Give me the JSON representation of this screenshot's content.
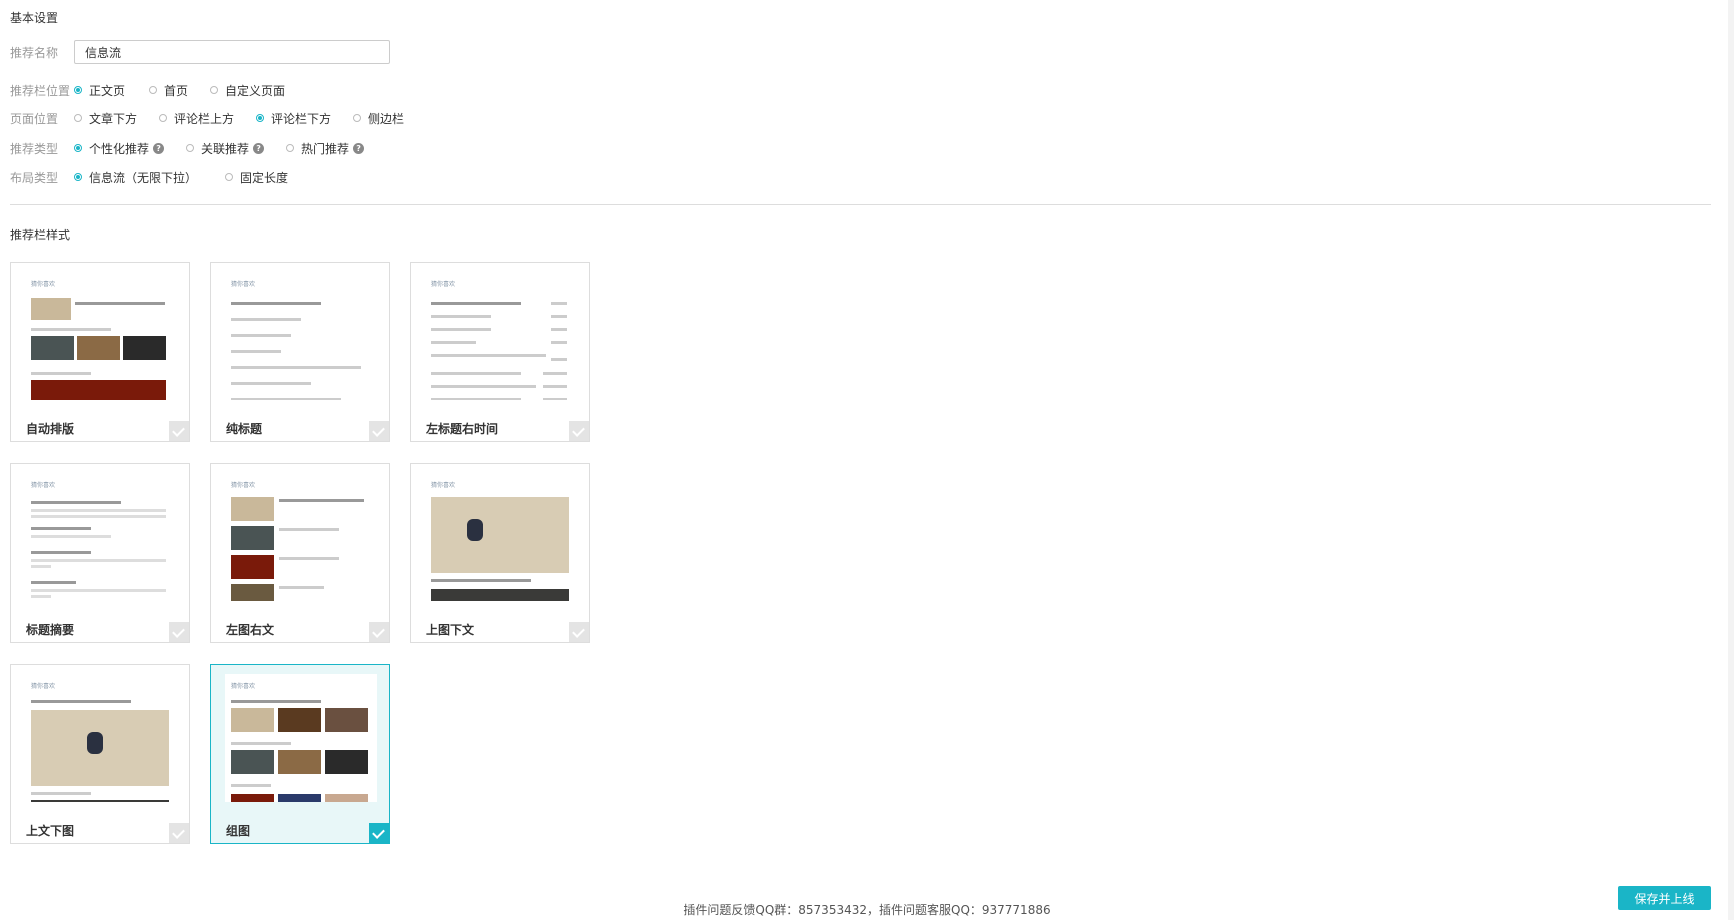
{
  "basic": {
    "title": "基本设置",
    "name_label": "推荐名称",
    "name_value": "信息流",
    "position_label": "推荐栏位置",
    "position_options": [
      "正文页",
      "首页",
      "自定义页面"
    ],
    "page_pos_label": "页面位置",
    "page_pos_options": [
      "文章下方",
      "评论栏上方",
      "评论栏下方",
      "侧边栏"
    ],
    "type_label": "推荐类型",
    "type_options": [
      "个性化推荐",
      "关联推荐",
      "热门推荐"
    ],
    "layout_label": "布局类型",
    "layout_options": [
      "信息流（无限下拉）",
      "固定长度"
    ]
  },
  "style": {
    "title": "推荐栏样式",
    "cards": [
      "自动排版",
      "纯标题",
      "左标题右时间",
      "标题摘要",
      "左图右文",
      "上图下文",
      "上文下图",
      "组图"
    ],
    "preview_header": "猜你喜欢",
    "selected": "组图"
  },
  "footer": {
    "text": "插件问题反馈QQ群：857353432，插件问题客服QQ：937771886",
    "save_button": "保存并上线"
  },
  "colors": {
    "accent": "#1ab5c7"
  },
  "icons": {
    "help": "help-icon",
    "check": "check-icon"
  }
}
